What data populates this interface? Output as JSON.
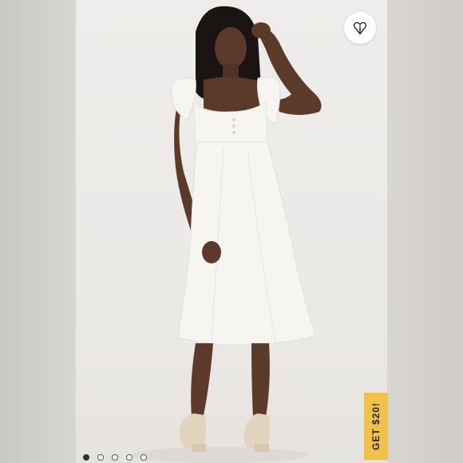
{
  "product": {
    "images_total": 5,
    "active_image_index": 0
  },
  "favorite": {
    "icon": "heart-outline-icon"
  },
  "promo": {
    "label": "GET $20!",
    "color": "#f1c14a"
  },
  "colors": {
    "background_sides": "#d6d4d1",
    "photo_background": "#ecebe8",
    "dress": "#f6f5f2",
    "skin": "#5b3a2a",
    "hair": "#1a1412"
  }
}
